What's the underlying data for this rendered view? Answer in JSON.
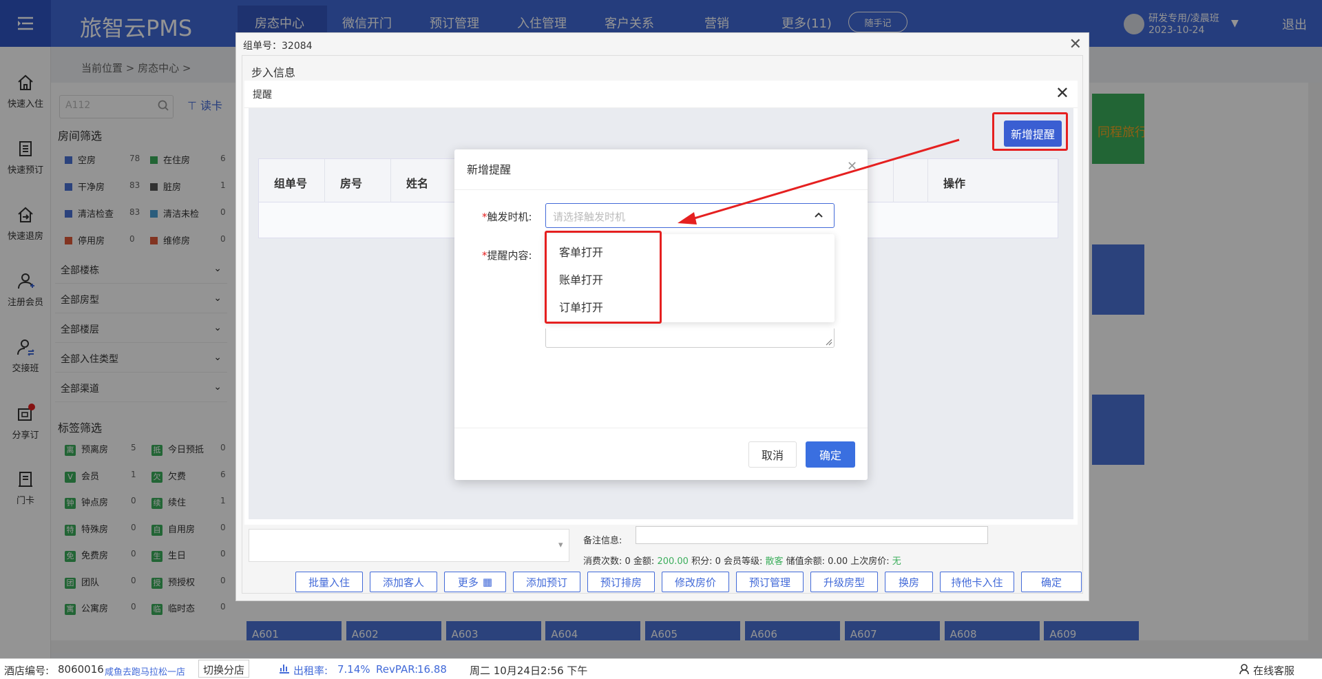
{
  "app": {
    "brand": "旅智云PMS",
    "nav": [
      "房态中心",
      "微信开门",
      "预订管理",
      "入住管理",
      "客户关系",
      "营销",
      "更多(11)"
    ],
    "memo_button": "随手记",
    "user_name": "研发专用/凌晨班",
    "user_date": "2023-10-24",
    "logout": "退出"
  },
  "sidebar": {
    "items": [
      {
        "label": "快速入住",
        "icon": "home-icon"
      },
      {
        "label": "快速预订",
        "icon": "document-icon"
      },
      {
        "label": "快速退房",
        "icon": "checkout-icon"
      },
      {
        "label": "注册会员",
        "icon": "user-add-icon"
      },
      {
        "label": "交接班",
        "icon": "user-swap-icon"
      },
      {
        "label": "分享订",
        "icon": "share-icon"
      },
      {
        "label": "门卡",
        "icon": "card-icon"
      }
    ]
  },
  "breadcrumb": "当前位置 > 房态中心 >",
  "left_panel": {
    "search_placeholder": "A112",
    "read_card": "读卡",
    "room_filter_title": "房间筛选",
    "room_filters": [
      {
        "label": "空房",
        "count": "78",
        "color": "#4a73d6"
      },
      {
        "label": "在住房",
        "count": "6",
        "color": "#3cae5c"
      },
      {
        "label": "干净房",
        "count": "83",
        "color": "#4a73d6"
      },
      {
        "label": "脏房",
        "count": "1",
        "color": "#555555"
      },
      {
        "label": "清洁检查",
        "count": "83",
        "color": "#4a73d6"
      },
      {
        "label": "清洁未检",
        "count": "0",
        "color": "#4aa0d6"
      },
      {
        "label": "停用房",
        "count": "0",
        "color": "#e05a3a"
      },
      {
        "label": "维修房",
        "count": "0",
        "color": "#e05a3a"
      }
    ],
    "dropdowns": [
      "全部楼栋",
      "全部房型",
      "全部楼层",
      "全部入住类型",
      "全部渠道"
    ],
    "tag_filter_title": "标签筛选",
    "tags": [
      {
        "badge": "离",
        "label": "预离房",
        "count": "5"
      },
      {
        "badge": "抵",
        "label": "今日预抵",
        "count": "0"
      },
      {
        "badge": "V",
        "label": "会员",
        "count": "1"
      },
      {
        "badge": "欠",
        "label": "欠费",
        "count": "6"
      },
      {
        "badge": "钟",
        "label": "钟点房",
        "count": "0"
      },
      {
        "badge": "续",
        "label": "续住",
        "count": "1"
      },
      {
        "badge": "特",
        "label": "特殊房",
        "count": "0"
      },
      {
        "badge": "自",
        "label": "自用房",
        "count": "0"
      },
      {
        "badge": "免",
        "label": "免费房",
        "count": "0"
      },
      {
        "badge": "生",
        "label": "生日",
        "count": "0"
      },
      {
        "badge": "团",
        "label": "团队",
        "count": "0"
      },
      {
        "badge": "授",
        "label": "预授权",
        "count": "0"
      },
      {
        "badge": "寓",
        "label": "公寓房",
        "count": "0"
      },
      {
        "badge": "临",
        "label": "临时态",
        "count": "0"
      }
    ]
  },
  "room_tiles": [
    "A601",
    "A602",
    "A603",
    "A604",
    "A605",
    "A606",
    "A607",
    "A608",
    "A609"
  ],
  "tongcheng_label": "同程旅行",
  "group_dialog": {
    "title": "组单号：32084",
    "section": "步入信息",
    "memo_label": "备注信息:",
    "consume_prefix": "消费次数: 0 金额: ",
    "consume_amount": "200.00",
    "consume_mid": " 积分: 0 会员等级: ",
    "member_level": "散客",
    "consume_tail": " 储值余额: 0.00 上次房价: ",
    "last_price": "无",
    "buttons": [
      "批量入住",
      "添加客人",
      "更多",
      "添加预订",
      "预订排房",
      "修改房价",
      "预订管理",
      "升级房型",
      "换房",
      "持他卡入住",
      "确定"
    ]
  },
  "remind_dialog": {
    "title": "提醒",
    "add_button": "新增提醒",
    "columns": [
      "组单号",
      "房号",
      "姓名",
      "",
      "",
      "",
      "",
      "",
      "操作"
    ]
  },
  "add_dialog": {
    "title": "新增提醒",
    "trigger_label": "触发时机:",
    "trigger_placeholder": "请选择触发时机",
    "content_label": "提醒内容:",
    "options": [
      "客单打开",
      "账单打开",
      "订单打开"
    ],
    "cancel": "取消",
    "ok": "确定"
  },
  "statusbar": {
    "hotel_id_label": "酒店编号:",
    "hotel_id": "8060016",
    "hotel_name": "咸鱼去跑马拉松一店",
    "switch_store": "切换分店",
    "occupancy_label": "出租率:",
    "occupancy": "7.14%",
    "revpar_label": "RevPAR:",
    "revpar": "16.88",
    "datetime": "周二 10月24日2:56 下午",
    "support": "在线客服"
  },
  "colors": {
    "primary": "#4169d8",
    "highlight": "#e52020",
    "tag_green": "#3cae5c"
  }
}
